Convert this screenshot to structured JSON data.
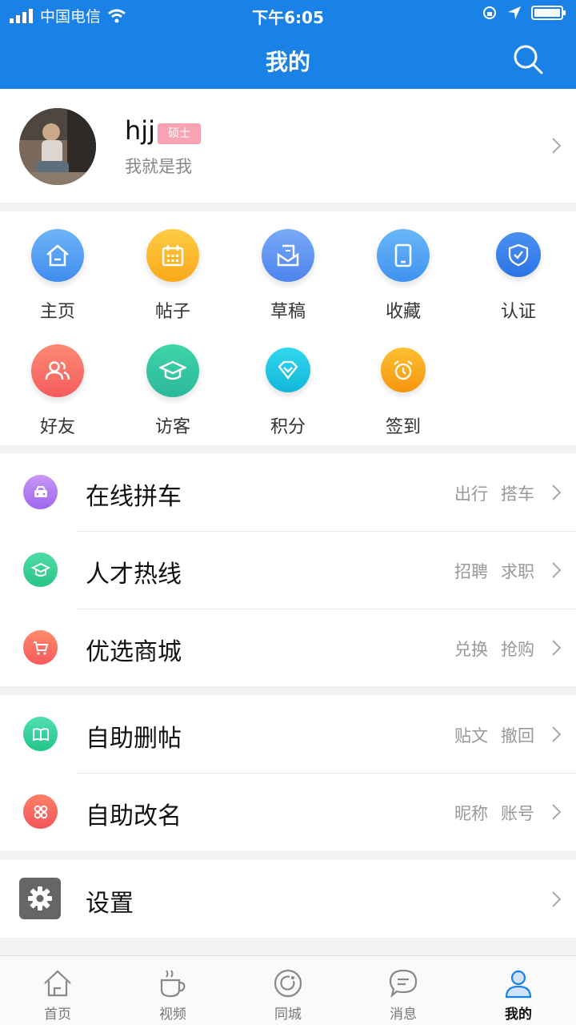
{
  "status_bar": {
    "carrier": "中国电信",
    "time": "下午6:05"
  },
  "nav": {
    "title": "我的"
  },
  "profile": {
    "username": "hjj",
    "badge": "硕士",
    "signature": "我就是我"
  },
  "grid": [
    {
      "label": "主页",
      "icon": "home-icon",
      "color": "#4f9bf0"
    },
    {
      "label": "帖子",
      "icon": "calendar-icon",
      "color": "#fbb92a"
    },
    {
      "label": "草稿",
      "icon": "draft-icon",
      "color": "#5b90f2"
    },
    {
      "label": "收藏",
      "icon": "tablet-icon",
      "color": "#4aa0f3"
    },
    {
      "label": "认证",
      "icon": "shield-icon",
      "color": "#3f8af0"
    },
    {
      "label": "好友",
      "icon": "friends-icon",
      "color": "#f76f6a"
    },
    {
      "label": "访客",
      "icon": "graduation-cap-icon",
      "color": "#37c7a4"
    },
    {
      "label": "积分",
      "icon": "diamond-icon",
      "color": "#19c8e3"
    },
    {
      "label": "签到",
      "icon": "alarm-clock-icon",
      "color": "#f9a91a"
    }
  ],
  "section1": [
    {
      "title": "在线拼车",
      "tags": [
        "出行",
        "搭车"
      ],
      "icon": "taxi-icon",
      "color": "#b57ff0"
    },
    {
      "title": "人才热线",
      "tags": [
        "招聘",
        "求职"
      ],
      "icon": "graduation-cap-icon",
      "color": "#35d18f"
    },
    {
      "title": "优选商城",
      "tags": [
        "兑换",
        "抢购"
      ],
      "icon": "cart-icon",
      "color": "#fa7160"
    }
  ],
  "section2": [
    {
      "title": "自助删帖",
      "tags": [
        "贴文",
        "撤回"
      ],
      "icon": "book-icon",
      "color": "#33d39a"
    },
    {
      "title": "自助改名",
      "tags": [
        "昵称",
        "账号"
      ],
      "icon": "apps-icon",
      "color": "#fb6e62"
    }
  ],
  "settings": {
    "title": "设置"
  },
  "tabbar": [
    {
      "label": "首页",
      "icon": "home-tab-icon",
      "active": false
    },
    {
      "label": "视频",
      "icon": "coffee-cup-icon",
      "active": false
    },
    {
      "label": "同城",
      "icon": "refresh-circle-icon",
      "active": false
    },
    {
      "label": "消息",
      "icon": "chat-bubble-icon",
      "active": false
    },
    {
      "label": "我的",
      "icon": "person-icon",
      "active": true
    }
  ],
  "colors": {
    "brand": "#1a82e6",
    "badge": "#f8a3b4"
  }
}
